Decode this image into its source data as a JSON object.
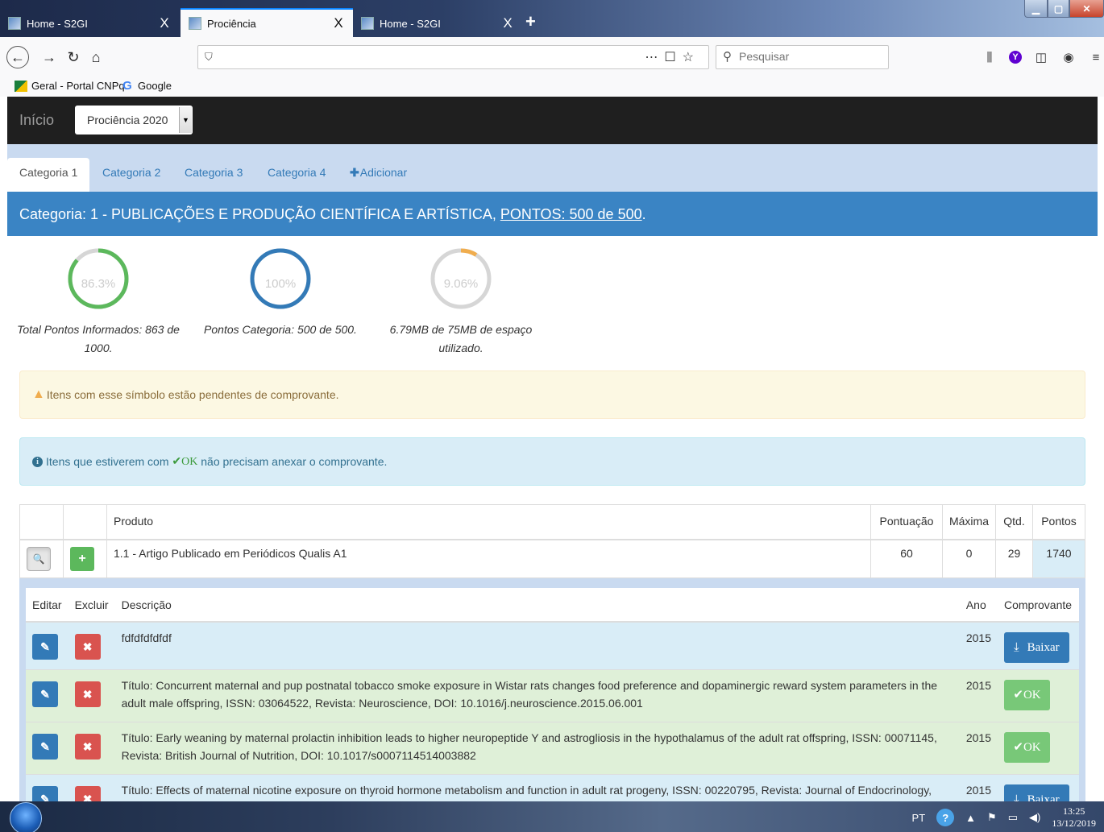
{
  "browser": {
    "tabs": [
      {
        "title": "Home - S2GI",
        "active": false
      },
      {
        "title": "Prociência",
        "active": true
      },
      {
        "title": "Home - S2GI",
        "active": false
      }
    ],
    "close_glyph": "X",
    "new_tab_glyph": "+",
    "search_placeholder": "Pesquisar",
    "bookmarks": [
      {
        "label": "Geral - Portal CNPq",
        "icon": "cnpq-icon"
      },
      {
        "label": "Google",
        "icon": "google-icon"
      }
    ]
  },
  "app": {
    "brand": "Início",
    "year_select": "Prociência 2020",
    "tabs": [
      "Categoria 1",
      "Categoria 2",
      "Categoria 3",
      "Categoria 4"
    ],
    "add_tab": "Adicionar",
    "category_title": "Categoria: 1 - PUBLICAÇÕES E PRODUÇÃO CIENTÍFICA E ARTÍSTICA, ",
    "category_points": "PONTOS: 500 de 500",
    "category_suffix": ".",
    "gauges": [
      {
        "percent_label": "86.3%",
        "fraction": 0.863,
        "color": "#5cb85c",
        "caption": "Total Pontos Informados: 863 de 1000."
      },
      {
        "percent_label": "100%",
        "fraction": 1.0,
        "color": "#337ab7",
        "caption": "Pontos Categoria: 500 de 500."
      },
      {
        "percent_label": "9.06%",
        "fraction": 0.0906,
        "color": "#f0ad4e",
        "caption": "6.79MB de 75MB de espaço utilizado."
      }
    ],
    "alert_warning": "Itens com esse símbolo estão pendentes de comprovante.",
    "alert_info_prefix": "Itens que estiverem com ",
    "alert_info_ok": "✔OK",
    "alert_info_suffix": " não precisam anexar o comprovante.",
    "table": {
      "headers": [
        "",
        "",
        "Produto",
        "Pontuação",
        "Máxima",
        "Qtd.",
        "Pontos"
      ],
      "row": {
        "produto": "1.1 - Artigo Publicado em Periódicos Qualis A1",
        "pontuacao": "60",
        "maxima": "0",
        "qtd": "29",
        "pontos": "1740"
      }
    },
    "subtable": {
      "headers": [
        "Editar",
        "Excluir",
        "Descrição",
        "Ano",
        "Comprovante"
      ],
      "download_label": "Baixar",
      "ok_label": "✔OK",
      "rows": [
        {
          "descricao": "fdfdfdfdfdf",
          "ano": "2015",
          "comprovante": "download",
          "style": "info"
        },
        {
          "descricao": "Título: Concurrent maternal and pup postnatal tobacco smoke exposure in Wistar rats changes food preference and dopaminergic reward system parameters in the adult male offspring, ISSN: 03064522, Revista: Neuroscience, DOI: 10.1016/j.neuroscience.2015.06.001",
          "ano": "2015",
          "comprovante": "ok",
          "style": "ok"
        },
        {
          "descricao": "Título: Early weaning by maternal prolactin inhibition leads to higher neuropeptide Y and astrogliosis in the hypothalamus of the adult rat offspring, ISSN: 00071145, Revista: British Journal of Nutrition, DOI: 10.1017/s0007114514003882",
          "ano": "2015",
          "comprovante": "ok",
          "style": "ok"
        },
        {
          "descricao": "Título: Effects of maternal nicotine exposure on thyroid hormone metabolism and function in adult rat progeny, ISSN: 00220795, Revista: Journal of Endocrinology, DOI:",
          "ano": "2015",
          "comprovante": "download",
          "style": "info"
        }
      ]
    }
  },
  "taskbar": {
    "lang": "PT",
    "time": "13:25",
    "date": "13/12/2019"
  }
}
